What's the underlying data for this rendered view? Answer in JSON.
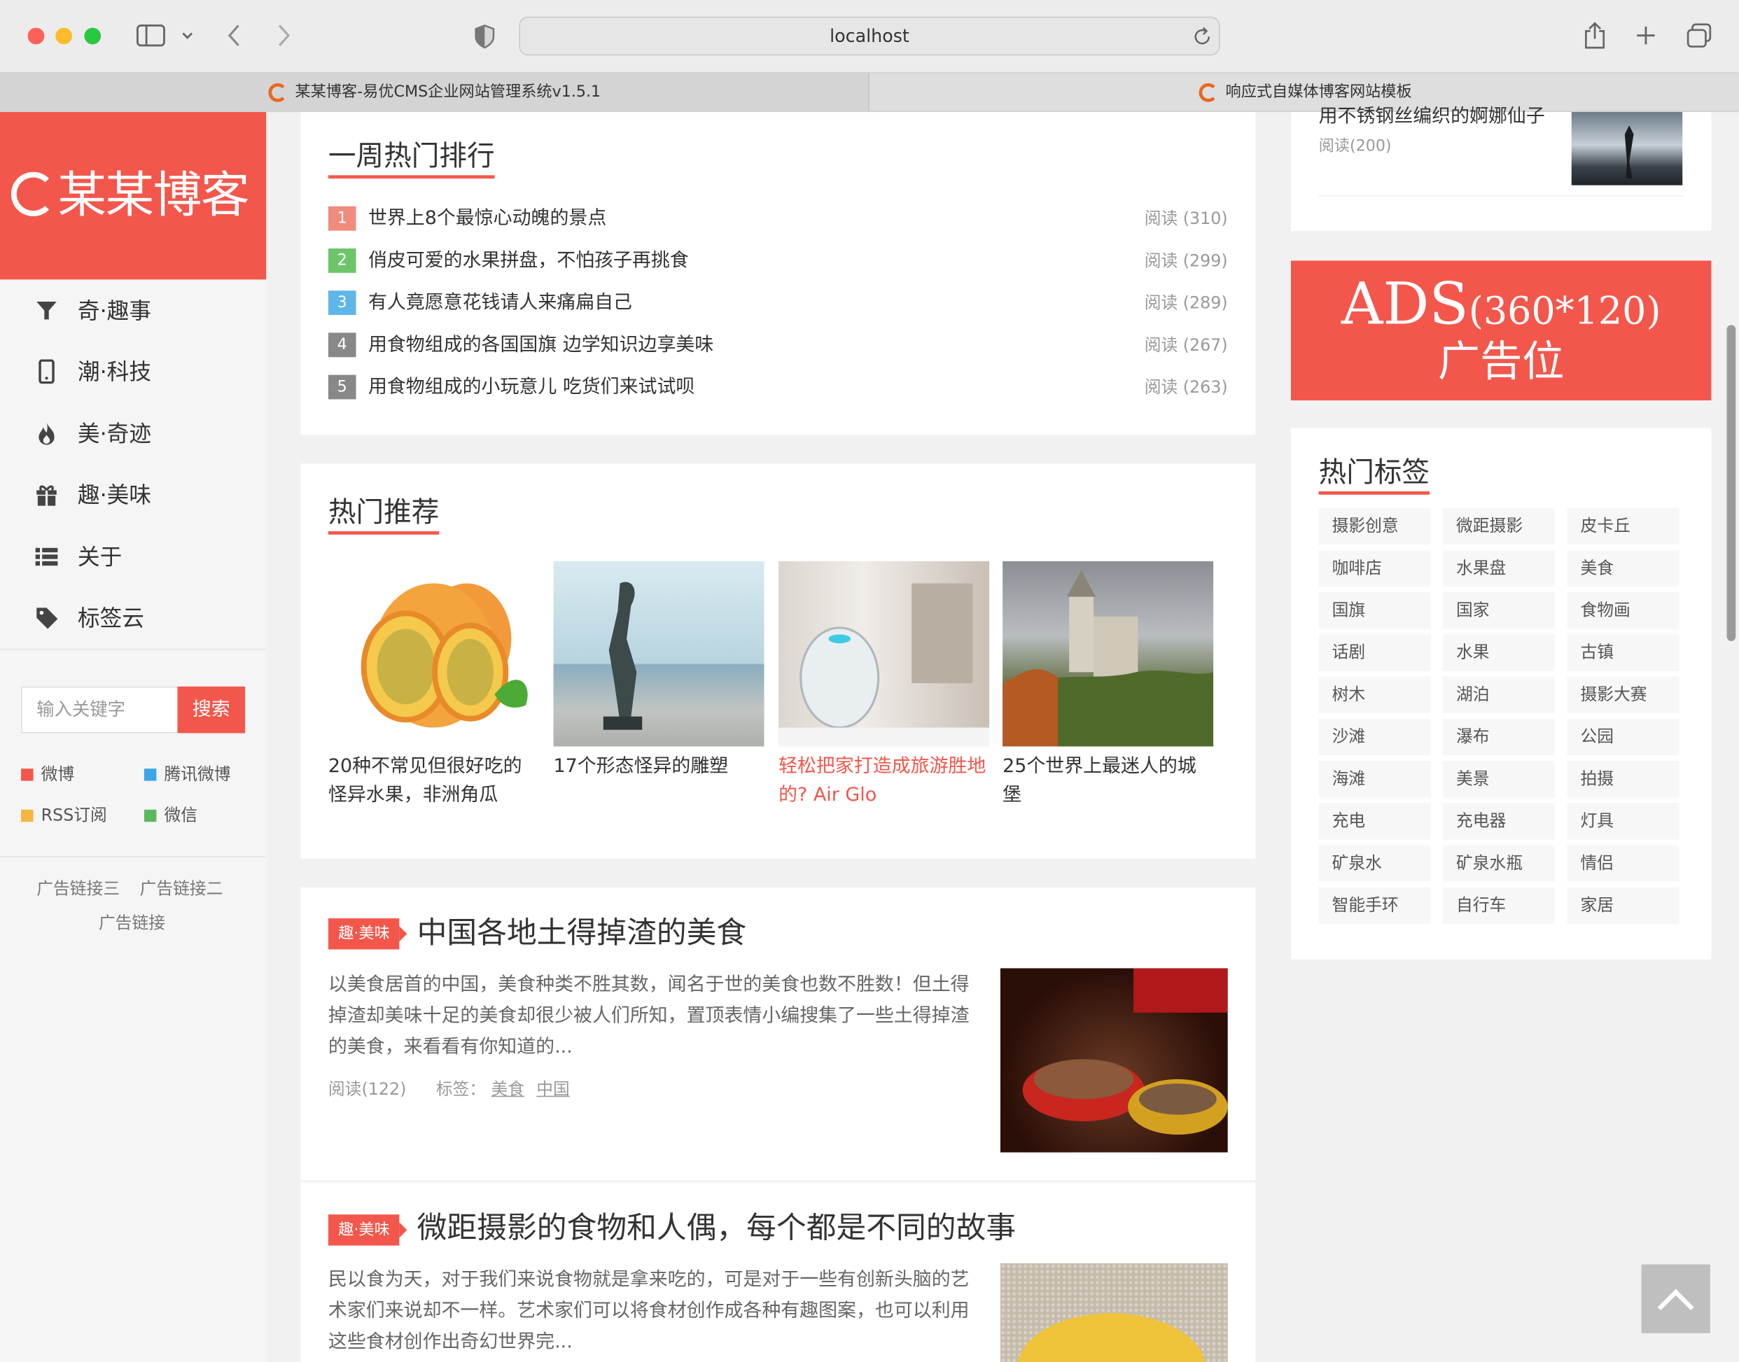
{
  "browser": {
    "url": "localhost",
    "tabs": [
      {
        "label": "某某博客-易优CMS企业网站管理系统v1.5.1"
      },
      {
        "label": "响应式自媒体博客网站模板"
      }
    ]
  },
  "sidebar": {
    "logo": "某某博客",
    "nav": [
      {
        "label": "奇·趣事",
        "icon": "filter-icon"
      },
      {
        "label": "潮·科技",
        "icon": "phone-icon"
      },
      {
        "label": "美·奇迹",
        "icon": "fire-icon"
      },
      {
        "label": "趣·美味",
        "icon": "gift-icon"
      },
      {
        "label": "关于",
        "icon": "list-icon"
      },
      {
        "label": "标签云",
        "icon": "tag-icon"
      }
    ],
    "search": {
      "placeholder": "输入关键字",
      "button": "搜索"
    },
    "social": [
      {
        "label": "微博",
        "color": "#f3574c"
      },
      {
        "label": "腾讯微博",
        "color": "#3aa6e6"
      },
      {
        "label": "RSS订阅",
        "color": "#f4b63f"
      },
      {
        "label": "微信",
        "color": "#5cb85c"
      }
    ],
    "ad_links": [
      "广告链接三",
      "广告链接二",
      "广告链接"
    ]
  },
  "weekly": {
    "title": "一周热门排行",
    "items": [
      {
        "rank": "1",
        "title": "世界上8个最惊心动魄的景点",
        "reads": "阅读 (310)",
        "color": "#f08b7e"
      },
      {
        "rank": "2",
        "title": "俏皮可爱的水果拼盘，不怕孩子再挑食",
        "reads": "阅读 (299)",
        "color": "#6cc56b"
      },
      {
        "rank": "3",
        "title": "有人竟愿意花钱请人来痛扁自己",
        "reads": "阅读 (289)",
        "color": "#5fb6e8"
      },
      {
        "rank": "4",
        "title": "用食物组成的各国国旗 边学知识边享美味",
        "reads": "阅读 (267)",
        "color": "#888888"
      },
      {
        "rank": "5",
        "title": "用食物组成的小玩意儿 吃货们来试试呗",
        "reads": "阅读 (263)",
        "color": "#888888"
      }
    ]
  },
  "hot": {
    "title": "热门推荐",
    "items": [
      {
        "title": "20种不常见但很好吃的怪异水果，非洲角瓜"
      },
      {
        "title": "17个形态怪异的雕塑"
      },
      {
        "title": "轻松把家打造成旅游胜地的? Air Glo"
      },
      {
        "title": "25个世界上最迷人的城堡"
      }
    ]
  },
  "articles": [
    {
      "category": "趣·美味",
      "title": "中国各地土得掉渣的美食",
      "excerpt": "以美食居首的中国，美食种类不胜其数，闻名于世的美食也数不胜数！但土得掉渣却美味十足的美食却很少被人们所知，置顶表情小编搜集了一些土得掉渣的美食，来看看有你知道的...",
      "reads": "阅读(122)",
      "tags_label": "标签：",
      "tags": [
        "美食",
        "中国"
      ]
    },
    {
      "category": "趣·美味",
      "title": "微距摄影的食物和人偶，每个都是不同的故事",
      "excerpt": "民以食为天，对于我们来说食物就是拿来吃的，可是对于一些有创新头脑的艺术家们来说却不一样。艺术家们可以将食材创作成各种有趣图案，也可以利用这些食材创作出奇幻世界完..."
    }
  ],
  "right": {
    "top_item": {
      "title": "用不锈钢丝编织的婀娜仙子",
      "reads": "阅读(200)"
    },
    "ad": {
      "line1": "ADS",
      "line1b": "(360*120)",
      "line2": "广告位"
    },
    "tags_title": "热门标签",
    "tags": [
      "摄影创意",
      "微距摄影",
      "皮卡丘",
      "咖啡店",
      "水果盘",
      "美食",
      "国旗",
      "国家",
      "食物画",
      "话剧",
      "水果",
      "古镇",
      "树木",
      "湖泊",
      "摄影大赛",
      "沙滩",
      "瀑布",
      "公园",
      "海滩",
      "美景",
      "拍摄",
      "充电",
      "充电器",
      "灯具",
      "矿泉水",
      "矿泉水瓶",
      "情侣",
      "智能手环",
      "自行车",
      "家居"
    ]
  }
}
